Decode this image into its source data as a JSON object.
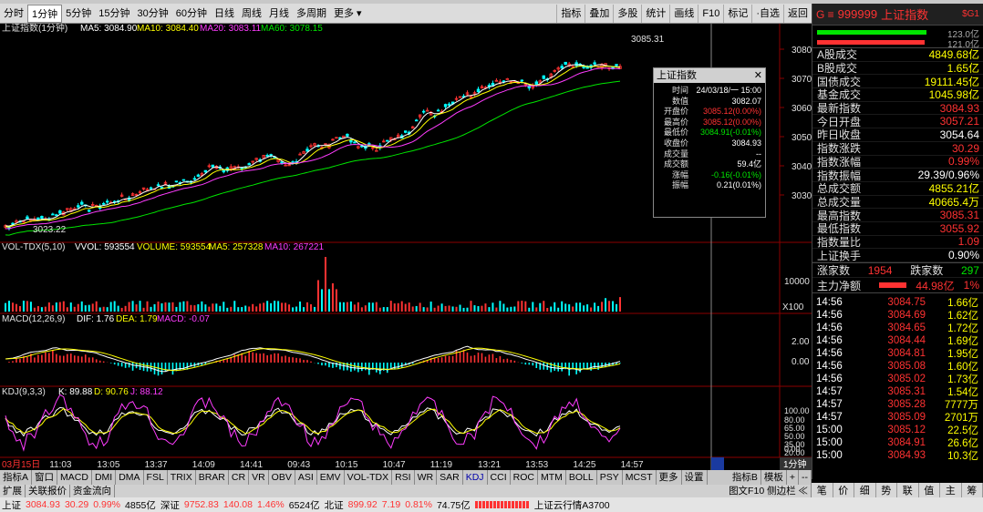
{
  "toolbar": {
    "left": [
      "分时",
      "1分钟",
      "5分钟",
      "15分钟",
      "30分钟",
      "60分钟",
      "日线",
      "周线",
      "月线",
      "多周期",
      "更多 ▾"
    ],
    "right": [
      "指标",
      "叠加",
      "多股",
      "统计",
      "画线",
      "F10",
      "标记",
      "·自选",
      "返回"
    ]
  },
  "main": {
    "title": "上证指数(1分钟)",
    "ma5": "MA5: 3084.90",
    "ma10": "MA10: 3084.40",
    "ma20": "MA20: 3083.11",
    "ma60": "MA60: 3078.15",
    "hi_label": "3085.31",
    "lo_label": "3023.22",
    "yticks": [
      "3080",
      "3070",
      "3060",
      "3050",
      "3040",
      "3030"
    ]
  },
  "vol": {
    "title": "VOL-TDX(5,10)",
    "vvol": "VVOL: 593554",
    "volume": "VOLUME: 593554",
    "ma5": "MA5: 257328",
    "ma10": "MA10: 267221",
    "ytick": "10000",
    "unit": "X100"
  },
  "macd": {
    "title": "MACD(12,26,9)",
    "dif": "DIF: 1.76",
    "dea": "DEA: 1.79",
    "macd": "MACD: -0.07",
    "yticks": [
      "2.00",
      "0.00"
    ]
  },
  "kdj": {
    "title": "KDJ(9,3,3)",
    "k": "K: 89.88",
    "d": "D: 90.76",
    "j": "J: 88.12",
    "yticks": [
      "100.00",
      "80.00",
      "65.00",
      "50.00",
      "35.00",
      "20.00",
      "0.00"
    ]
  },
  "xaxis": [
    "03月15日",
    "11:03",
    "13:05",
    "13:37",
    "14:09",
    "14:41",
    "09:43",
    "10:15",
    "10:47",
    "11:19",
    "13:21",
    "13:53",
    "14:25",
    "14:57"
  ],
  "period_btn": "1分钟",
  "infobox": {
    "title": "上证指数",
    "rows": [
      [
        "时间",
        "24/03/18/一 15:00"
      ],
      [
        "数值",
        "3082.07"
      ],
      [
        "开盘价",
        "3085.12(0.00%)"
      ],
      [
        "最高价",
        "3085.12(0.00%)"
      ],
      [
        "最低价",
        "3084.91(-0.01%)"
      ],
      [
        "收盘价",
        "3084.93"
      ],
      [
        "成交量",
        "--"
      ],
      [
        "成交额",
        "59.4亿"
      ],
      [
        "涨幅",
        "-0.16(-0.01%)"
      ],
      [
        "振幅",
        "0.21(0.01%)"
      ]
    ]
  },
  "panel": {
    "code": "999999",
    "name": "上证指数",
    "tag": "$G1",
    "g": "G ≡",
    "bar1": "123.0亿",
    "bar2": "121.0亿",
    "rows": [
      [
        "A股成交",
        "4849.68亿",
        "yel"
      ],
      [
        "B股成交",
        "1.65亿",
        "yel"
      ],
      [
        "国债成交",
        "19111.45亿",
        "yel"
      ],
      [
        "基金成交",
        "1045.98亿",
        "yel"
      ],
      [
        "最新指数",
        "3084.93",
        "red"
      ],
      [
        "今日开盘",
        "3057.21",
        "red"
      ],
      [
        "昨日收盘",
        "3054.64",
        "white"
      ],
      [
        "指数涨跌",
        "30.29",
        "red"
      ],
      [
        "指数涨幅",
        "0.99%",
        "red"
      ],
      [
        "指数振幅",
        "29.39/0.96%",
        "white"
      ],
      [
        "总成交额",
        "4855.21亿",
        "yel"
      ],
      [
        "总成交量",
        "40665.4万",
        "yel"
      ],
      [
        "最高指数",
        "3085.31",
        "red"
      ],
      [
        "最低指数",
        "3055.92",
        "red"
      ],
      [
        "指数量比",
        "1.09",
        "red"
      ],
      [
        "上证换手",
        "0.90%",
        "white"
      ]
    ],
    "updown": {
      "up_k": "涨家数",
      "up": "1954",
      "dn_k": "跌家数",
      "dn": "297"
    },
    "net": {
      "k": "主力净额",
      "v": "44.98亿",
      "p": "1%"
    },
    "ticks": [
      [
        "14:56",
        "3084.75",
        "1.66亿"
      ],
      [
        "14:56",
        "3084.69",
        "1.62亿"
      ],
      [
        "14:56",
        "3084.65",
        "1.72亿"
      ],
      [
        "14:56",
        "3084.44",
        "1.69亿"
      ],
      [
        "14:56",
        "3084.81",
        "1.95亿"
      ],
      [
        "14:56",
        "3085.08",
        "1.60亿"
      ],
      [
        "14:56",
        "3085.02",
        "1.73亿"
      ],
      [
        "14:57",
        "3085.31",
        "1.54亿"
      ],
      [
        "14:57",
        "3085.28",
        "7777万"
      ],
      [
        "14:57",
        "3085.09",
        "2701万"
      ],
      [
        "15:00",
        "3085.12",
        "22.5亿"
      ],
      [
        "15:00",
        "3084.91",
        "26.6亿"
      ],
      [
        "15:00",
        "3084.93",
        "10.3亿"
      ]
    ]
  },
  "bottom_tabs": [
    "指标A",
    "窗口",
    "MACD",
    "DMI",
    "DMA",
    "FSL",
    "TRIX",
    "BRAR",
    "CR",
    "VR",
    "OBV",
    "ASI",
    "EMV",
    "VOL-TDX",
    "RSI",
    "WR",
    "SAR",
    "KDJ",
    "CCI",
    "ROC",
    "MTM",
    "BOLL",
    "PSY",
    "MCST",
    "更多",
    "设置"
  ],
  "bottom_tabs2": [
    "指标B",
    "模板",
    "+",
    "--"
  ],
  "sub_tabs": [
    "扩展",
    "关联报价",
    "资金流向"
  ],
  "rp_bottom": [
    "笔",
    "价",
    "细",
    "势",
    "联",
    "值",
    "主",
    "筹"
  ],
  "rp_bottom_note": "图文F10 侧边栏 ≪",
  "status": {
    "sh_k": "上证",
    "sh": "3084.93",
    "sh_c": "30.29",
    "sh_p": "0.99%",
    "sh_v": "4855亿",
    "sz_k": "深证",
    "sz": "9752.83",
    "sz_c": "140.08",
    "sz_p": "1.46%",
    "sz_v": "6524亿",
    "bz_k": "北证",
    "bz": "899.92",
    "bz_c": "7.19",
    "bz_p": "0.81%",
    "bz_v": "74.75亿",
    "news": "上证云行情A3700"
  }
}
